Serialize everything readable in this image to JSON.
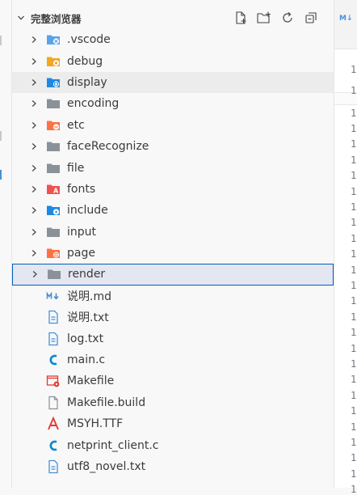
{
  "explorer": {
    "title": "完整浏览器",
    "actions": [
      {
        "name": "new-file-icon"
      },
      {
        "name": "new-folder-icon"
      },
      {
        "name": "refresh-icon"
      },
      {
        "name": "collapse-all-icon"
      }
    ],
    "items": [
      {
        "label": ".vscode",
        "type": "folder",
        "icon": "vscode-folder-icon",
        "color": "#5ba3e8",
        "state": "normal"
      },
      {
        "label": "debug",
        "type": "folder",
        "icon": "debug-folder-icon",
        "color": "#f4a521",
        "state": "normal"
      },
      {
        "label": "display",
        "type": "folder",
        "icon": "display-folder-icon",
        "color": "#1e88e5",
        "state": "hover"
      },
      {
        "label": "encoding",
        "type": "folder",
        "icon": "folder-icon",
        "color": "#8a9199",
        "state": "normal"
      },
      {
        "label": "etc",
        "type": "folder",
        "icon": "etc-folder-icon",
        "color": "#ff7043",
        "state": "normal"
      },
      {
        "label": "faceRecognize",
        "type": "folder",
        "icon": "folder-icon",
        "color": "#8a9199",
        "state": "normal"
      },
      {
        "label": "file",
        "type": "folder",
        "icon": "folder-icon",
        "color": "#8a9199",
        "state": "normal"
      },
      {
        "label": "fonts",
        "type": "folder",
        "icon": "fonts-folder-icon",
        "color": "#ef5350",
        "state": "normal"
      },
      {
        "label": "include",
        "type": "folder",
        "icon": "include-folder-icon",
        "color": "#1e88e5",
        "state": "normal"
      },
      {
        "label": "input",
        "type": "folder",
        "icon": "folder-icon",
        "color": "#8a9199",
        "state": "normal"
      },
      {
        "label": "page",
        "type": "folder",
        "icon": "page-folder-icon",
        "color": "#ff7043",
        "state": "normal"
      },
      {
        "label": "render",
        "type": "folder",
        "icon": "folder-icon",
        "color": "#8a9199",
        "state": "focused"
      },
      {
        "label": "说明.md",
        "type": "file",
        "icon": "markdown-icon",
        "color": "#4a8fd8",
        "state": "normal"
      },
      {
        "label": "说明.txt",
        "type": "file",
        "icon": "text-file-icon",
        "color": "#4a8fd8",
        "state": "normal"
      },
      {
        "label": "log.txt",
        "type": "file",
        "icon": "text-file-icon",
        "color": "#4a8fd8",
        "state": "normal"
      },
      {
        "label": "main.c",
        "type": "file",
        "icon": "c-file-icon",
        "color": "#0288d1",
        "state": "normal"
      },
      {
        "label": "Makefile",
        "type": "file",
        "icon": "makefile-icon",
        "color": "#e53935",
        "state": "normal"
      },
      {
        "label": "Makefile.build",
        "type": "file",
        "icon": "generic-file-icon",
        "color": "#8a9199",
        "state": "normal"
      },
      {
        "label": "MSYH.TTF",
        "type": "file",
        "icon": "font-file-icon",
        "color": "#e53935",
        "state": "normal"
      },
      {
        "label": "netprint_client.c",
        "type": "file",
        "icon": "c-file-icon",
        "color": "#0288d1",
        "state": "normal"
      },
      {
        "label": "utf8_novel.txt",
        "type": "file",
        "icon": "text-file-icon",
        "color": "#4a8fd8",
        "state": "normal"
      }
    ]
  },
  "editor": {
    "tab_icon": "M↓",
    "line_number_glyph": "1"
  }
}
